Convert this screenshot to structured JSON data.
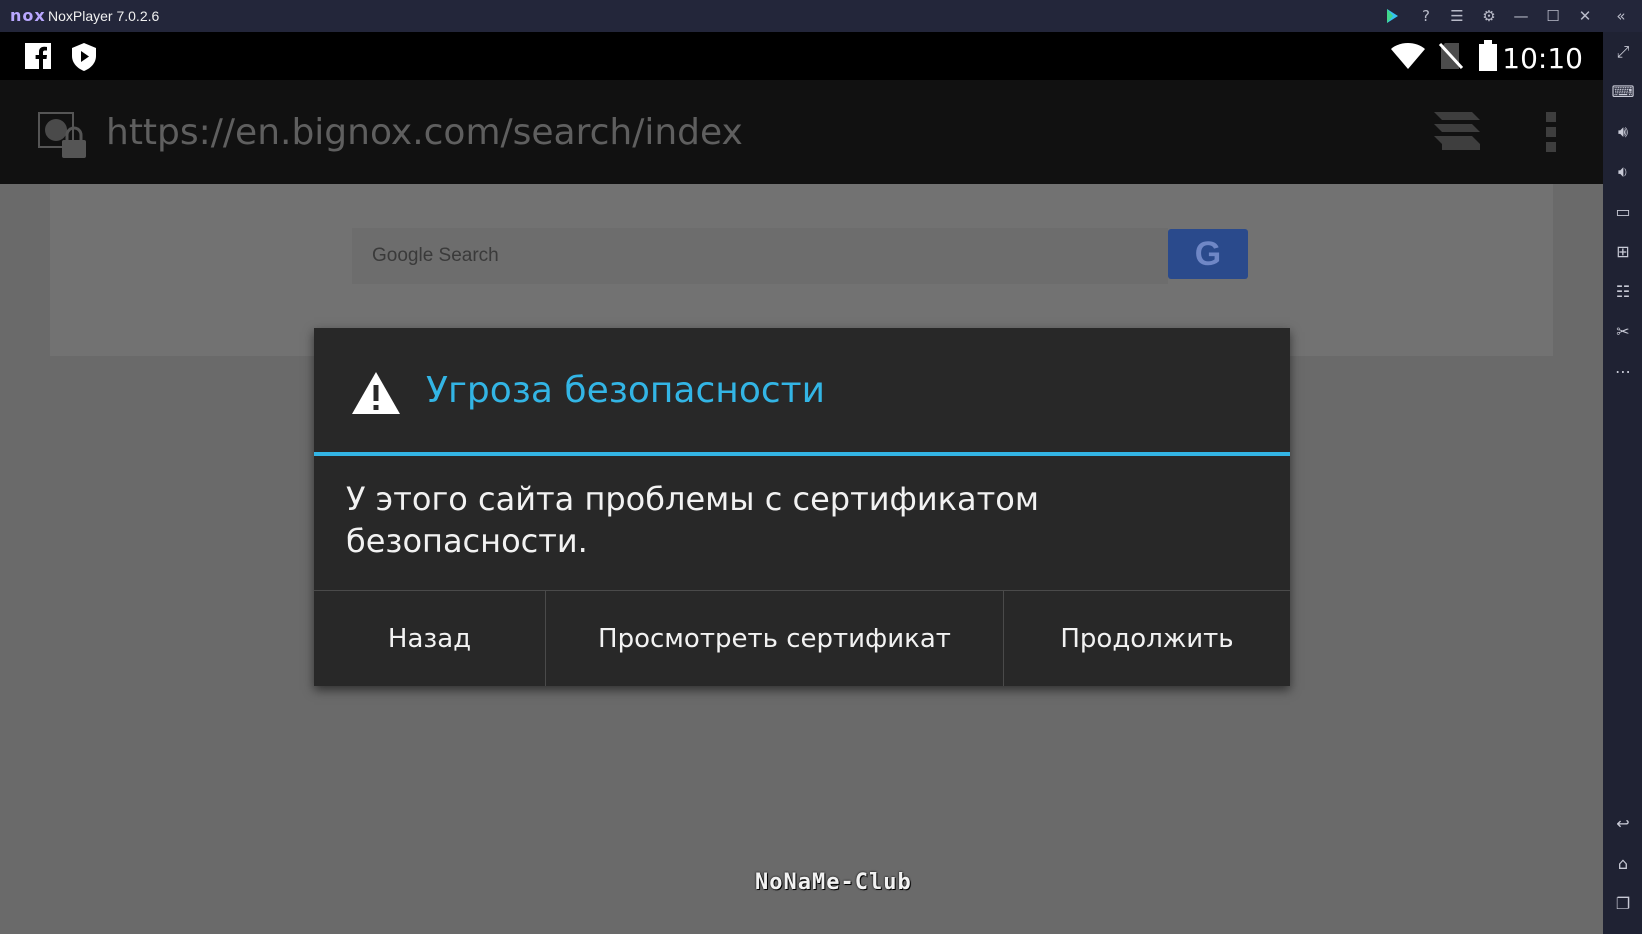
{
  "window": {
    "logo": "nox",
    "title": "NoxPlayer 7.0.2.6",
    "controls": {
      "play": "play-store-icon",
      "help": "?",
      "menu": "☰",
      "settings": "⚙",
      "minimize": "—",
      "maximize": "☐",
      "close": "✕",
      "collapse": "«"
    }
  },
  "status_bar": {
    "time": "10:10",
    "icons": [
      "facebook-icon",
      "play-protect-icon",
      "wifi-icon",
      "no-sim-icon",
      "battery-icon"
    ]
  },
  "browser": {
    "url": "https://en.bignox.com/search/index"
  },
  "page": {
    "search_placeholder": "Google Search",
    "search_button": "G",
    "search_button_color": "#2a4a8c"
  },
  "dialog": {
    "title": "Угроза безопасности",
    "message": "У этого сайта проблемы с сертификатом безопасности.",
    "accent_color": "#33b5e5",
    "buttons": {
      "back": "Назад",
      "view_certificate": "Просмотреть сертификат",
      "continue": "Продолжить"
    }
  },
  "watermark": "NoNaMe-Club"
}
